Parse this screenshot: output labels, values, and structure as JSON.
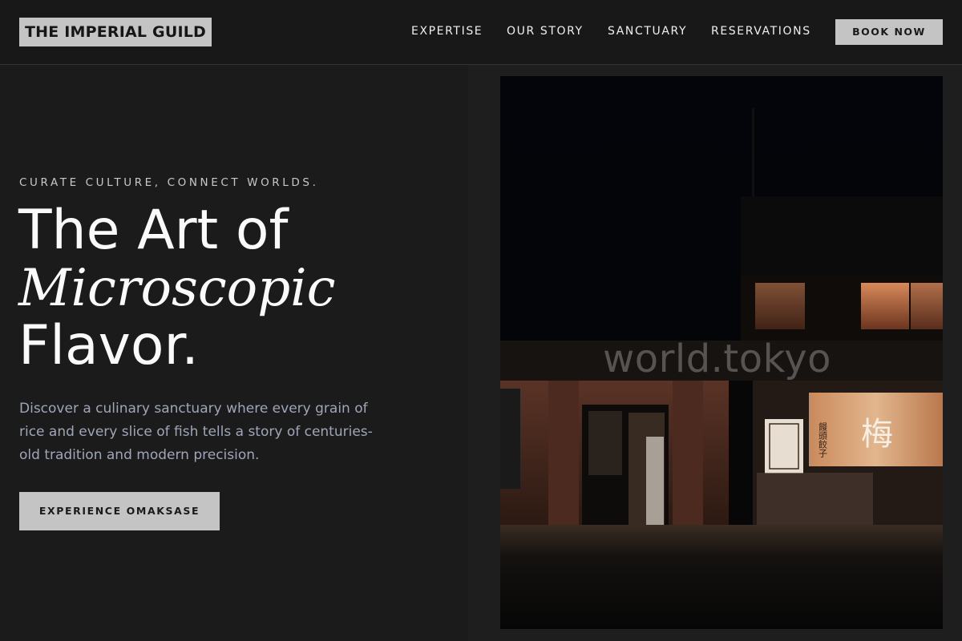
{
  "header": {
    "logo": "THE IMPERIAL GUILD",
    "nav": [
      {
        "label": "EXPERTISE"
      },
      {
        "label": "OUR STORY"
      },
      {
        "label": "SANCTUARY"
      },
      {
        "label": "RESERVATIONS"
      }
    ],
    "book_label": "BOOK NOW"
  },
  "hero": {
    "eyebrow": "CURATE CULTURE, CONNECT WORLDS.",
    "headline_1": "The Art of",
    "headline_2": "Microscopic",
    "headline_3": "Flavor.",
    "description": "Discover a culinary sanctuary where every grain of rice and every slice of fish tells a story of centuries-old tradition and modern precision.",
    "cta_label": "EXPERIENCE OMAKSASE"
  },
  "image": {
    "watermark": "world.tokyo",
    "sign_text": "梅",
    "menu_text": "饅頭餃子"
  },
  "colors": {
    "background": "#1b1b1b",
    "button": "#c4c4c4",
    "description": "#9fa6b8"
  }
}
